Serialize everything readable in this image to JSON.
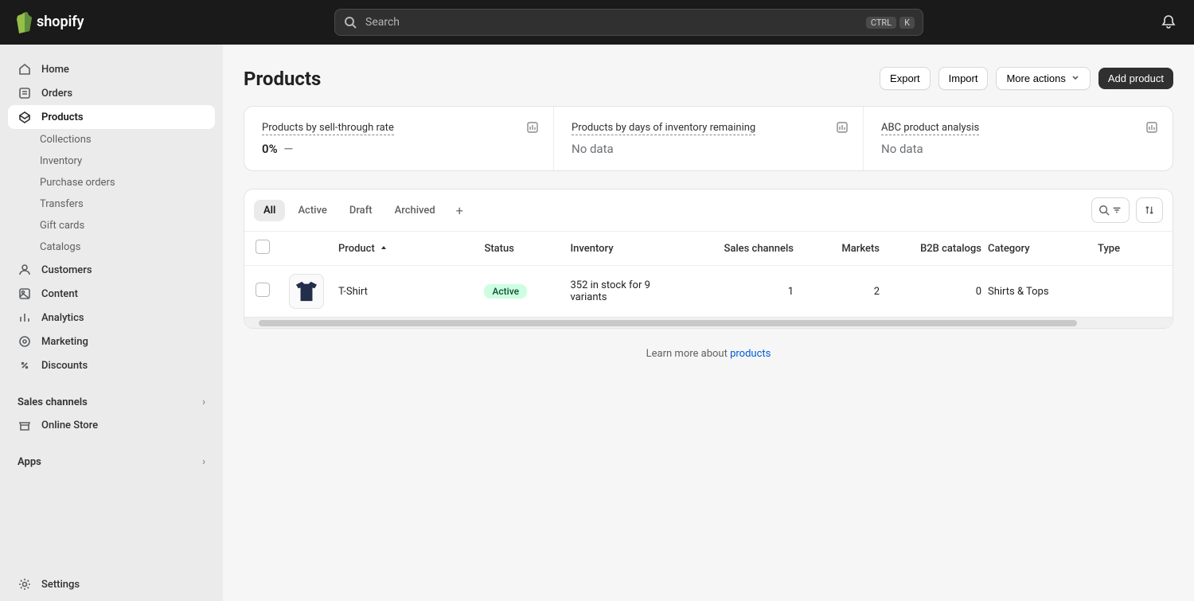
{
  "search": {
    "placeholder": "Search",
    "kbd1": "CTRL",
    "kbd2": "K"
  },
  "sidebar": {
    "items": [
      {
        "label": "Home"
      },
      {
        "label": "Orders"
      },
      {
        "label": "Products"
      },
      {
        "label": "Collections"
      },
      {
        "label": "Inventory"
      },
      {
        "label": "Purchase orders"
      },
      {
        "label": "Transfers"
      },
      {
        "label": "Gift cards"
      },
      {
        "label": "Catalogs"
      },
      {
        "label": "Customers"
      },
      {
        "label": "Content"
      },
      {
        "label": "Analytics"
      },
      {
        "label": "Marketing"
      },
      {
        "label": "Discounts"
      }
    ],
    "sales_channels": {
      "header": "Sales channels",
      "store": "Online Store"
    },
    "apps": {
      "header": "Apps"
    },
    "settings": "Settings"
  },
  "page": {
    "title": "Products"
  },
  "actions": {
    "export": "Export",
    "import": "Import",
    "more": "More actions",
    "add": "Add product"
  },
  "stats": [
    {
      "title": "Products by sell-through rate",
      "value": "0%",
      "dash": "—"
    },
    {
      "title": "Products by days of inventory remaining",
      "value": "No data"
    },
    {
      "title": "ABC product analysis",
      "value": "No data"
    }
  ],
  "tabs": {
    "items": [
      "All",
      "Active",
      "Draft",
      "Archived"
    ],
    "plus": "+"
  },
  "columns": {
    "product": "Product",
    "status": "Status",
    "inventory": "Inventory",
    "sales": "Sales channels",
    "markets": "Markets",
    "b2b": "B2B catalogs",
    "category": "Category",
    "type": "Type"
  },
  "rows": [
    {
      "name": "T-Shirt",
      "status": "Active",
      "inventory": "352 in stock for 9 variants",
      "sales": "1",
      "markets": "2",
      "b2b": "0",
      "category": "Shirts & Tops",
      "type": ""
    }
  ],
  "learn": {
    "prefix": "Learn more about ",
    "link": "products"
  },
  "colors": {
    "accent": "#303030",
    "badge_bg": "#cdfee1",
    "badge_fg": "#0c5132",
    "link": "#005bd3"
  }
}
